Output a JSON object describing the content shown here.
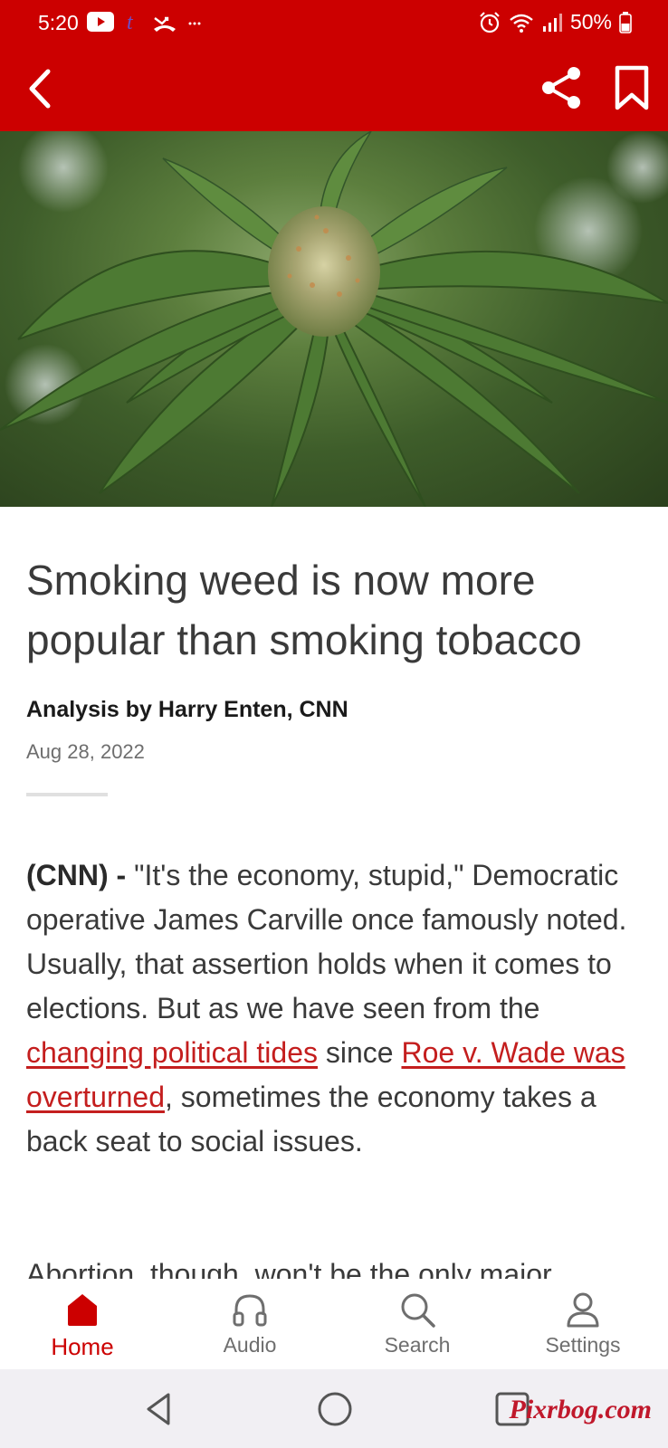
{
  "status_bar": {
    "time": "5:20",
    "battery": "50%",
    "left_icons": [
      "youtube-icon",
      "tumblr-icon",
      "missed-call-icon",
      "more-dots-icon"
    ],
    "right_icons": [
      "alarm-icon",
      "wifi-icon",
      "signal-icon",
      "battery-icon"
    ]
  },
  "app_bar": {
    "background": "#cc0000",
    "icons": [
      "back-arrow-icon",
      "share-icon",
      "bookmark-icon"
    ]
  },
  "hero_image": {
    "subject": "cannabis plant photo"
  },
  "article": {
    "headline": "Smoking weed is now more popular than smoking tobacco",
    "byline": "Analysis by Harry Enten, CNN",
    "date": "Aug 28, 2022",
    "dateline": "(CNN) -",
    "paragraph_1": {
      "part_1": " \"It's the economy, stupid,\" Democratic operative James Carville once famously noted. Usually, that assertion holds when it comes to elections. But as we have seen from the ",
      "link_1": "changing political tides",
      "part_2": " since ",
      "link_2": "Roe v. Wade was overturned",
      "part_3": ", sometimes the economy takes a back seat to social issues."
    },
    "paragraph_2_partial": "Abortion, though, won't be the only major"
  },
  "tab_bar": {
    "tabs": [
      {
        "label": "Home",
        "icon": "home-icon",
        "active": true
      },
      {
        "label": "Audio",
        "icon": "headphones-icon",
        "active": false
      },
      {
        "label": "Search",
        "icon": "search-icon",
        "active": false
      },
      {
        "label": "Settings",
        "icon": "person-icon",
        "active": false
      }
    ],
    "active_color": "#cc0000",
    "inactive_color": "#6e6e6e"
  },
  "system_nav": {
    "buttons": [
      "back-triangle-icon",
      "home-circle-icon",
      "recents-square-icon"
    ],
    "watermark": "Pixrbog.com"
  }
}
